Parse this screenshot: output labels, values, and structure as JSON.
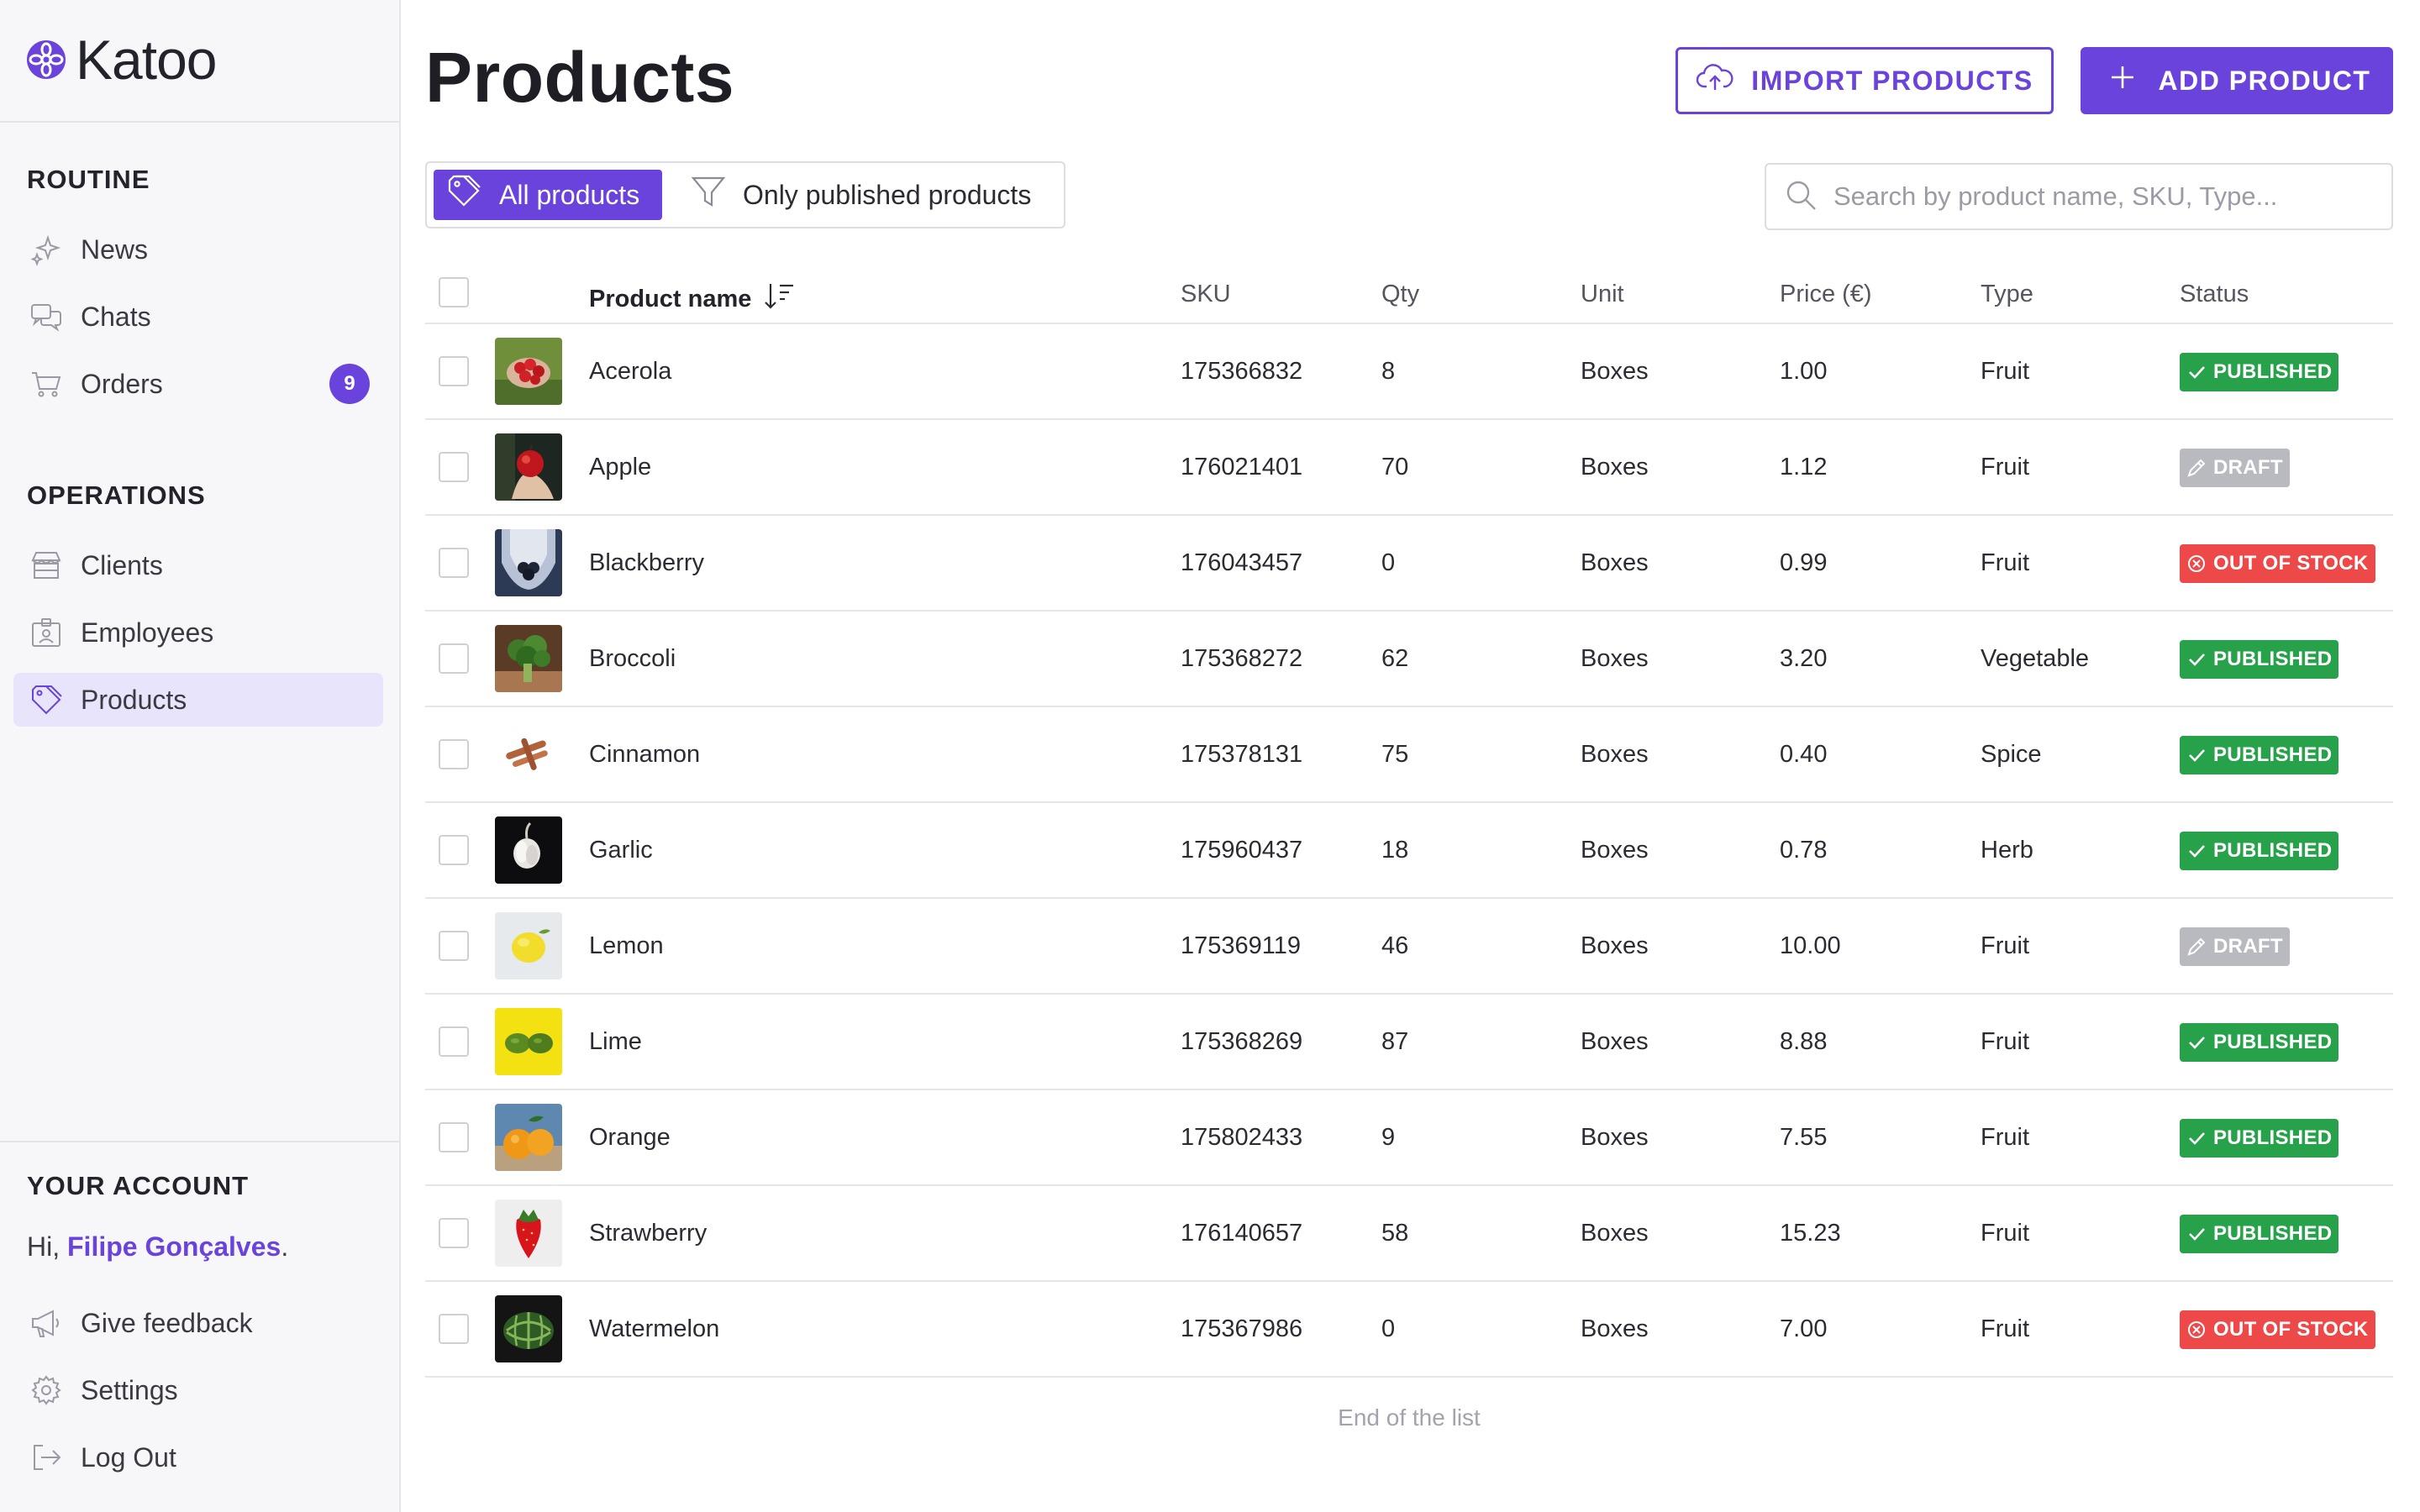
{
  "app": {
    "name": "Katoo"
  },
  "sidebar": {
    "routine_label": "ROUTINE",
    "routine_items": [
      {
        "label": "News",
        "icon": "sparkles-icon"
      },
      {
        "label": "Chats",
        "icon": "chat-bubbles-icon"
      },
      {
        "label": "Orders",
        "icon": "cart-icon",
        "badge": "9"
      }
    ],
    "operations_label": "OPERATIONS",
    "operations_items": [
      {
        "label": "Clients",
        "icon": "store-icon"
      },
      {
        "label": "Employees",
        "icon": "id-badge-icon"
      },
      {
        "label": "Products",
        "icon": "tag-icon",
        "active": true
      }
    ],
    "account_label": "YOUR ACCOUNT",
    "greeting_prefix": "Hi, ",
    "user_name": "Filipe Gonçalves",
    "greeting_suffix": ".",
    "account_items": [
      {
        "label": "Give feedback",
        "icon": "megaphone-icon"
      },
      {
        "label": "Settings",
        "icon": "gear-icon"
      },
      {
        "label": "Log Out",
        "icon": "logout-icon"
      }
    ]
  },
  "header": {
    "title": "Products",
    "import_label": "IMPORT PRODUCTS",
    "add_label": "ADD PRODUCT"
  },
  "filters": {
    "all_label": "All products",
    "published_label": "Only published products"
  },
  "search": {
    "placeholder": "Search by product name, SKU, Type..."
  },
  "table": {
    "columns": {
      "name": "Product name",
      "sku": "SKU",
      "qty": "Qty",
      "unit": "Unit",
      "price": "Price (€)",
      "type": "Type",
      "status": "Status"
    },
    "rows": [
      {
        "name": "Acerola",
        "sku": "175366832",
        "qty": "8",
        "unit": "Boxes",
        "price": "1.00",
        "type": "Fruit",
        "status": "PUBLISHED"
      },
      {
        "name": "Apple",
        "sku": "176021401",
        "qty": "70",
        "unit": "Boxes",
        "price": "1.12",
        "type": "Fruit",
        "status": "DRAFT"
      },
      {
        "name": "Blackberry",
        "sku": "176043457",
        "qty": "0",
        "unit": "Boxes",
        "price": "0.99",
        "type": "Fruit",
        "status": "OUT OF STOCK"
      },
      {
        "name": "Broccoli",
        "sku": "175368272",
        "qty": "62",
        "unit": "Boxes",
        "price": "3.20",
        "type": "Vegetable",
        "status": "PUBLISHED"
      },
      {
        "name": "Cinnamon",
        "sku": "175378131",
        "qty": "75",
        "unit": "Boxes",
        "price": "0.40",
        "type": "Spice",
        "status": "PUBLISHED"
      },
      {
        "name": "Garlic",
        "sku": "175960437",
        "qty": "18",
        "unit": "Boxes",
        "price": "0.78",
        "type": "Herb",
        "status": "PUBLISHED"
      },
      {
        "name": "Lemon",
        "sku": "175369119",
        "qty": "46",
        "unit": "Boxes",
        "price": "10.00",
        "type": "Fruit",
        "status": "DRAFT"
      },
      {
        "name": "Lime",
        "sku": "175368269",
        "qty": "87",
        "unit": "Boxes",
        "price": "8.88",
        "type": "Fruit",
        "status": "PUBLISHED"
      },
      {
        "name": "Orange",
        "sku": "175802433",
        "qty": "9",
        "unit": "Boxes",
        "price": "7.55",
        "type": "Fruit",
        "status": "PUBLISHED"
      },
      {
        "name": "Strawberry",
        "sku": "176140657",
        "qty": "58",
        "unit": "Boxes",
        "price": "15.23",
        "type": "Fruit",
        "status": "PUBLISHED"
      },
      {
        "name": "Watermelon",
        "sku": "175367986",
        "qty": "0",
        "unit": "Boxes",
        "price": "7.00",
        "type": "Fruit",
        "status": "OUT OF STOCK"
      }
    ],
    "end_text": "End of the list"
  },
  "colors": {
    "accent": "#6a43dc",
    "published": "#27a24a",
    "draft": "#b9b9c0",
    "out_of_stock": "#ee4949"
  }
}
